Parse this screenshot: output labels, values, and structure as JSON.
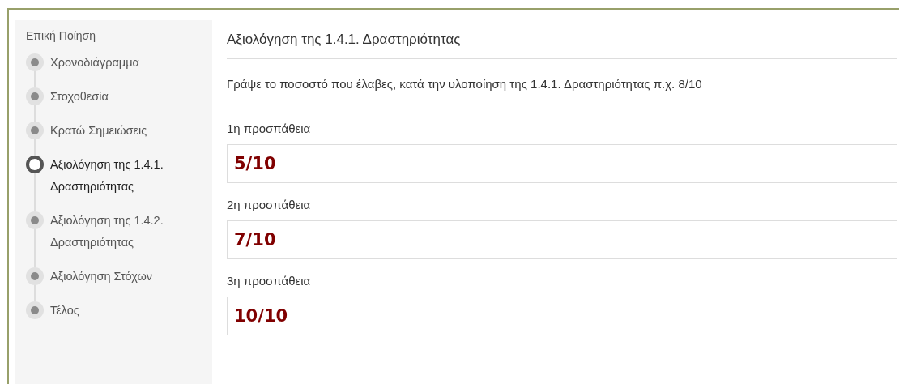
{
  "sidebar": {
    "title": "Επική Ποίηση",
    "items": [
      {
        "label": "Χρονοδιάγραμμα",
        "selected": false
      },
      {
        "label": "Στοχοθεσία",
        "selected": false
      },
      {
        "label": "Κρατώ Σημειώσεις",
        "selected": false
      },
      {
        "label": "Αξιολόγηση της 1.4.1. Δραστηριότητας",
        "selected": true
      },
      {
        "label": "Αξιολόγηση της 1.4.2. Δραστηριότητας",
        "selected": false
      },
      {
        "label": "Αξιολόγηση Στόχων",
        "selected": false
      },
      {
        "label": "Τέλος",
        "selected": false
      }
    ]
  },
  "main": {
    "title": "Αξιολόγηση της 1.4.1. Δραστηριότητας",
    "instruction": "Γράψε το ποσοστό που έλαβες, κατά την υλοποίηση της 1.4.1. Δραστηριότητας  π.χ. 8/10",
    "fields": [
      {
        "label": "1η προσπάθεια",
        "value": "5/10"
      },
      {
        "label": "2η προσπάθεια",
        "value": "7/10"
      },
      {
        "label": "3η προσπάθεια",
        "value": "10/10"
      }
    ]
  }
}
